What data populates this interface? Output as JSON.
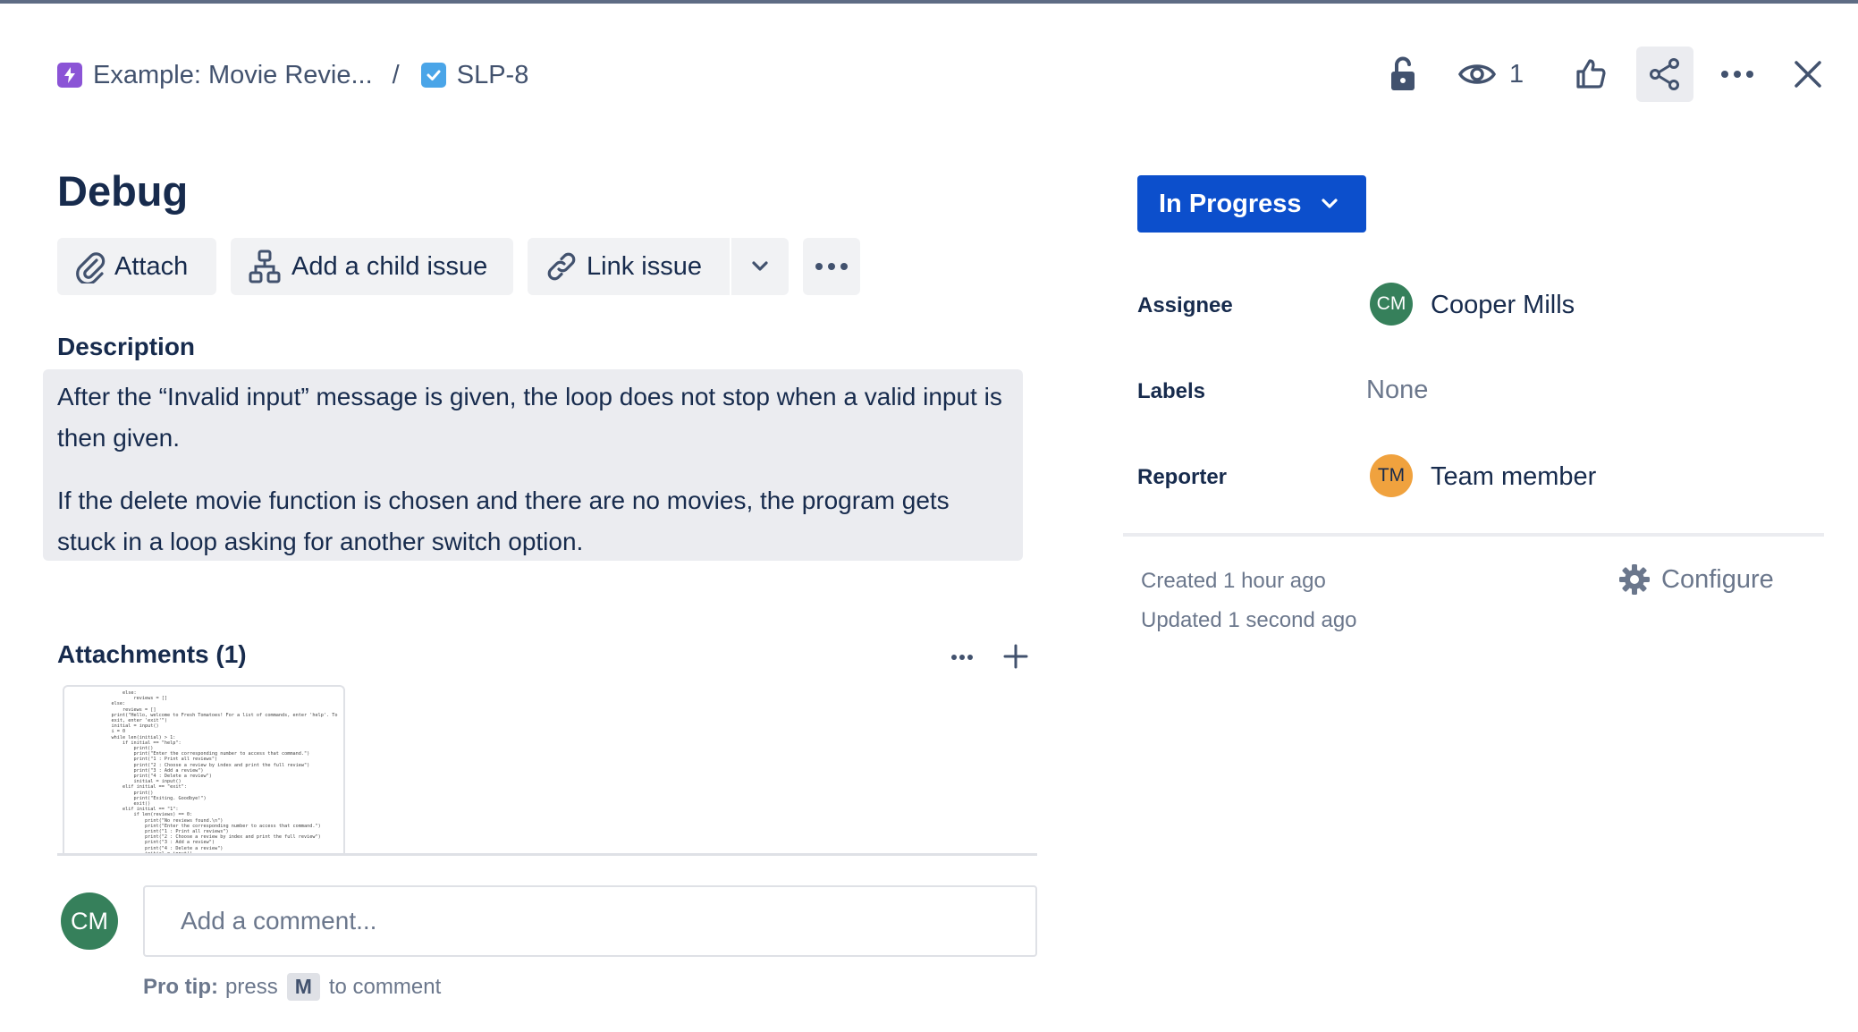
{
  "breadcrumb": {
    "project_name": "Example: Movie Revie...",
    "separator": "/",
    "issue_key": "SLP-8"
  },
  "header": {
    "watch_count": "1",
    "icons": [
      "lock-open-icon",
      "eye-icon",
      "thumbs-up-icon",
      "share-icon",
      "more-icon",
      "close-icon"
    ]
  },
  "issue": {
    "title": "Debug"
  },
  "toolbar": {
    "attach_label": "Attach",
    "child_issue_label": "Add a child issue",
    "link_issue_label": "Link issue"
  },
  "description": {
    "heading": "Description",
    "paragraph_1": "After the “Invalid input” message is given, the loop does not stop when a valid input is then given.",
    "paragraph_2": "If the delete movie function is chosen and there are no movies, the program gets stuck in a loop asking for another switch option."
  },
  "attachments": {
    "heading": "Attachments (1)"
  },
  "comment": {
    "avatar_initials": "CM",
    "placeholder": "Add a comment...",
    "pro_tip_label": "Pro tip:",
    "pro_tip_press": "press",
    "pro_tip_key": "M",
    "pro_tip_suffix": "to comment"
  },
  "status": {
    "label": "In Progress"
  },
  "fields": {
    "assignee_label": "Assignee",
    "assignee_initials": "CM",
    "assignee_name": "Cooper Mills",
    "labels_label": "Labels",
    "labels_value": "None",
    "reporter_label": "Reporter",
    "reporter_initials": "TM",
    "reporter_name": "Team member"
  },
  "meta": {
    "created": "Created 1 hour ago",
    "updated": "Updated 1 second ago",
    "configure_label": "Configure"
  },
  "colors": {
    "primary": "#0c4fcc",
    "text": "#172b4d",
    "subtle_text": "#6b778c",
    "cm_avatar": "#36805b",
    "tm_avatar": "#f0a23e",
    "epic": "#8b54d6",
    "task": "#4aa5e8"
  }
}
